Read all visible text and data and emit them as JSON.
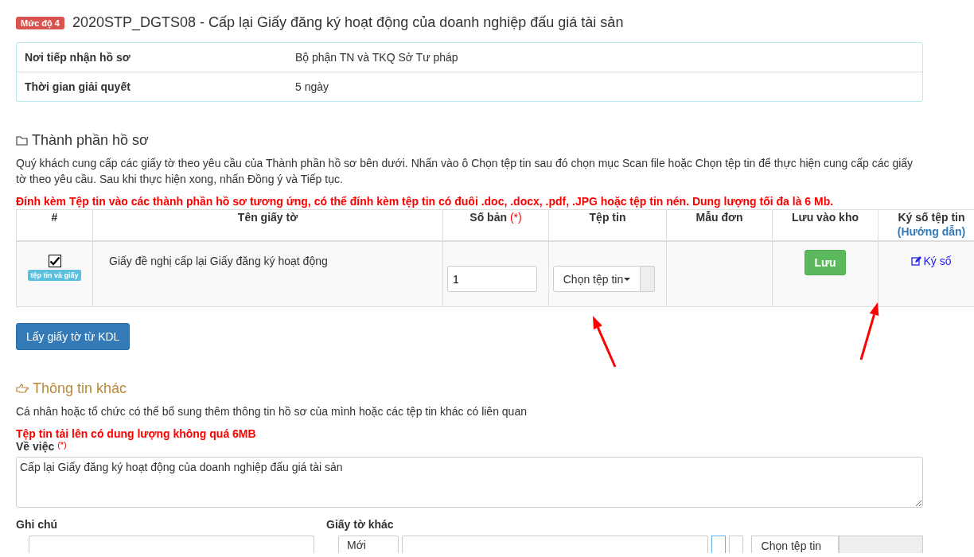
{
  "level_badge": "Mức độ 4",
  "title": "2020STP_DGTS08 - Cấp lại Giấy đăng ký hoạt động của doanh nghiệp đấu giá tài sản",
  "info": [
    {
      "label": "Nơi tiếp nhận hồ sơ",
      "value": "Bộ phận TN và TKQ Sở Tư pháp"
    },
    {
      "label": "Thời gian giải quyết",
      "value": "5 ngày"
    }
  ],
  "documents": {
    "heading": "Thành phần hồ sơ",
    "intro": "Quý khách cung cấp các giấy tờ theo yêu cầu của Thành phần hồ sơ bên dưới. Nhấn vào ô Chọn tệp tin sau đó chọn mục Scan file hoặc Chọn tệp tin để thực hiện cung cấp các giấy tờ theo yêu cầu. Sau khi thực hiện xong, nhấn Đồng ý và Tiếp tục.",
    "warning": "Đính kèm Tệp tin vào các thành phần hồ sơ tương ứng, có thể đính kèm tệp tin có đuôi .doc, .docx, .pdf, .JPG hoặc tệp tin nén. Dung lượng tối đa là 6 Mb.",
    "columns": [
      {
        "label": "#"
      },
      {
        "label": "Tên giấy tờ"
      },
      {
        "label": "Số bản",
        "required": "(*)"
      },
      {
        "label": "Tệp tin"
      },
      {
        "label": "Mẫu đơn"
      },
      {
        "label": "Lưu vào kho"
      },
      {
        "label": "Ký số tệp tin",
        "link": "(Hướng dẫn)"
      }
    ],
    "rows": [
      {
        "checked": true,
        "tag": "tệp tin và giấy",
        "name": "Giấy đề nghị cấp lại Giấy đăng ký hoạt động",
        "copies": "1",
        "file_button": "Chọn tệp tin",
        "save_button": "Lưu",
        "sign_link": "Ký số"
      }
    ],
    "fetch_button": "Lấy giấy tờ từ KDL"
  },
  "other": {
    "heading": "Thông tin khác",
    "intro": "Cá nhân hoặc tổ chức có thể bổ sung thêm thông tin hồ sơ của mình hoặc các tệp tin khác có liên quan",
    "warning": "Tệp tin tải lên có dung lượng không quá 6MB",
    "subject_label": "Về việc",
    "subject_required": "(*)",
    "subject_value": "Cấp lại Giấy đăng ký hoạt động của doanh nghiệp đấu giá tài sản",
    "note_label": "Ghi chú",
    "other_docs_label": "Giấy tờ khác",
    "type_select": "Mới",
    "file_button": "Chọn tệp tin"
  }
}
